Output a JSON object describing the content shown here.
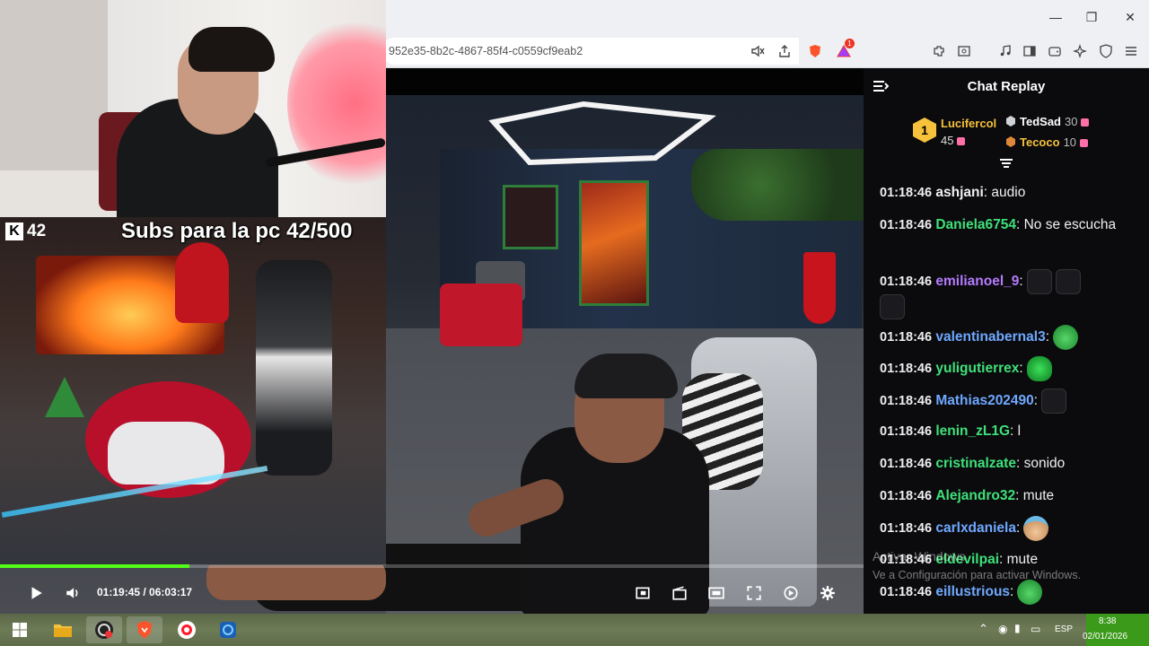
{
  "browser": {
    "url": "952e35-8b2c-4867-85f4-c0559cf9eab2",
    "window_controls": [
      "minimize",
      "maximize",
      "close"
    ],
    "shield_badge": "",
    "alert_badge": "1",
    "toolbar_icons": [
      "mute-tab-icon",
      "share-icon",
      "brave-shield-icon",
      "brave-rewards-icon",
      "extensions-icon",
      "reader-icon",
      "media-icon",
      "sidebar-icon",
      "wallet-icon",
      "leo-icon",
      "vpn-icon",
      "menu-icon"
    ]
  },
  "stream": {
    "kick_count": "42",
    "overlay_text": "Subs para la pc 42/500",
    "progress_fraction": 0.219,
    "time_current": "01:19:45",
    "time_total": "06:03:17",
    "time_display": "01:19:45 / 06:03:17"
  },
  "chat": {
    "title": "Chat Replay",
    "leaderboard": {
      "first": {
        "rank": "1",
        "name": "Lucifercol",
        "value": "45"
      },
      "others": [
        {
          "name": "TedSad",
          "value": "30",
          "color": "#ffffff"
        },
        {
          "name": "Tecoco",
          "value": "10",
          "color": "#f6c13b"
        }
      ]
    },
    "messages": [
      {
        "time": "01:18:46",
        "user": "ashjani",
        "color": "#efeff1",
        "text": ": audio"
      },
      {
        "time": "01:18:46",
        "user": "Daniela6754",
        "color": "#3fe07a",
        "text": ": No se escucha"
      },
      {
        "time": "01:18:46",
        "user": "emilianoel_9",
        "color": "#b57bff",
        "text": ":"
      },
      {
        "time": "01:18:46",
        "user": "valentinabernal3",
        "color": "#6fa8ff",
        "text": ":"
      },
      {
        "time": "01:18:46",
        "user": "yuligutierrex",
        "color": "#3fe07a",
        "text": ":"
      },
      {
        "time": "01:18:46",
        "user": "Mathias202490",
        "color": "#6fa8ff",
        "text": ":"
      },
      {
        "time": "01:18:46",
        "user": "lenin_zL1G",
        "color": "#3fe07a",
        "text": ": l"
      },
      {
        "time": "01:18:46",
        "user": "cristinalzate",
        "color": "#3fe07a",
        "text": ": sonido"
      },
      {
        "time": "01:18:46",
        "user": "Alejandro32",
        "color": "#3fe07a",
        "text": ": mute"
      },
      {
        "time": "01:18:46",
        "user": "carlxdaniela",
        "color": "#6fa8ff",
        "text": ":"
      },
      {
        "time": "01:18:46",
        "user": "eldevilpai",
        "color": "#3fe07a",
        "text": ": mute"
      },
      {
        "time": "01:18:46",
        "user": "eillustrious",
        "color": "#6fa8ff",
        "text": ":"
      }
    ],
    "watermark_line1": "Activar Windows",
    "watermark_line2": "Ve a Configuración para activar Windows."
  },
  "taskbar": {
    "apps": [
      "windows-start-icon",
      "file-explorer-icon",
      "obs-icon",
      "brave-browser-icon",
      "opera-icon",
      "app-icon"
    ],
    "language": "ESP",
    "time": "8:38",
    "date": "02/01/2026"
  },
  "colors": {
    "kick_green": "#53fc18",
    "chat_bg": "#0b0b0d",
    "taskbar_clock": "#3b9a1a"
  }
}
